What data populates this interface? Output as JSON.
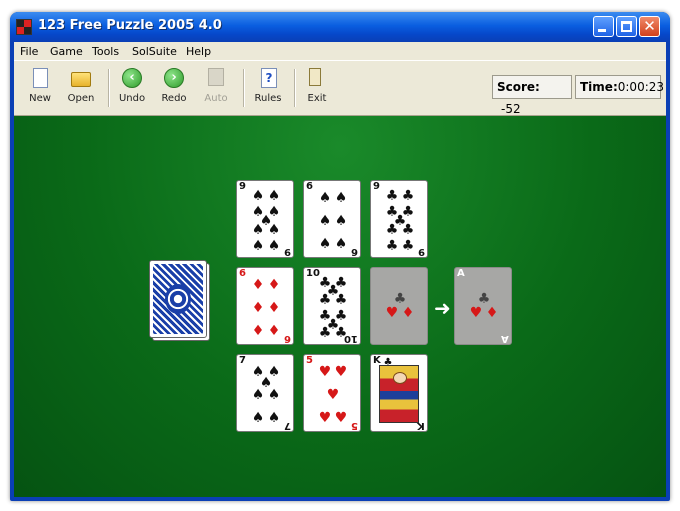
{
  "window": {
    "title": "123 Free Puzzle 2005 4.0",
    "close_glyph": "✕"
  },
  "menu": [
    "File",
    "Game",
    "Tools",
    "SolSuite",
    "Help"
  ],
  "toolbar": [
    {
      "label": "New",
      "icon": "new-document-icon",
      "enabled": true
    },
    {
      "label": "Open",
      "icon": "open-folder-icon",
      "enabled": true
    },
    {
      "label": "Undo",
      "icon": "undo-arrow-icon",
      "enabled": true
    },
    {
      "label": "Redo",
      "icon": "redo-arrow-icon",
      "enabled": true
    },
    {
      "label": "Auto",
      "icon": "auto-icon",
      "enabled": false
    },
    {
      "label": "Rules",
      "icon": "rules-help-icon",
      "enabled": true
    },
    {
      "label": "Exit",
      "icon": "exit-door-icon",
      "enabled": true
    }
  ],
  "status": {
    "score_label": "Score:",
    "score_value": "-52",
    "time_label": "Time:",
    "time_value": "0:00:23"
  },
  "board": {
    "row1": [
      {
        "rank": "9",
        "suit": "♠",
        "color": "black"
      },
      {
        "rank": "6",
        "suit": "♠",
        "color": "black"
      },
      {
        "rank": "9",
        "suit": "♣",
        "color": "black"
      }
    ],
    "row2": [
      {
        "rank": "6",
        "suit": "♦",
        "color": "red"
      },
      {
        "rank": "10",
        "suit": "♣",
        "color": "black"
      }
    ],
    "row3": [
      {
        "rank": "7",
        "suit": "♠",
        "color": "black"
      },
      {
        "rank": "5",
        "suit": "♥",
        "color": "red"
      },
      {
        "rank": "K",
        "suit": "♣",
        "color": "black"
      }
    ],
    "ghost_card": {
      "suits": [
        "♣",
        "♥",
        "♦"
      ]
    },
    "target_card": {
      "rank": "A",
      "suits": [
        "♣",
        "♥",
        "♦"
      ]
    },
    "arrow": "➜"
  },
  "colors": {
    "felt": "#0a6a18",
    "titlebar": "#0a5ee0",
    "red_suit": "#d61818"
  }
}
